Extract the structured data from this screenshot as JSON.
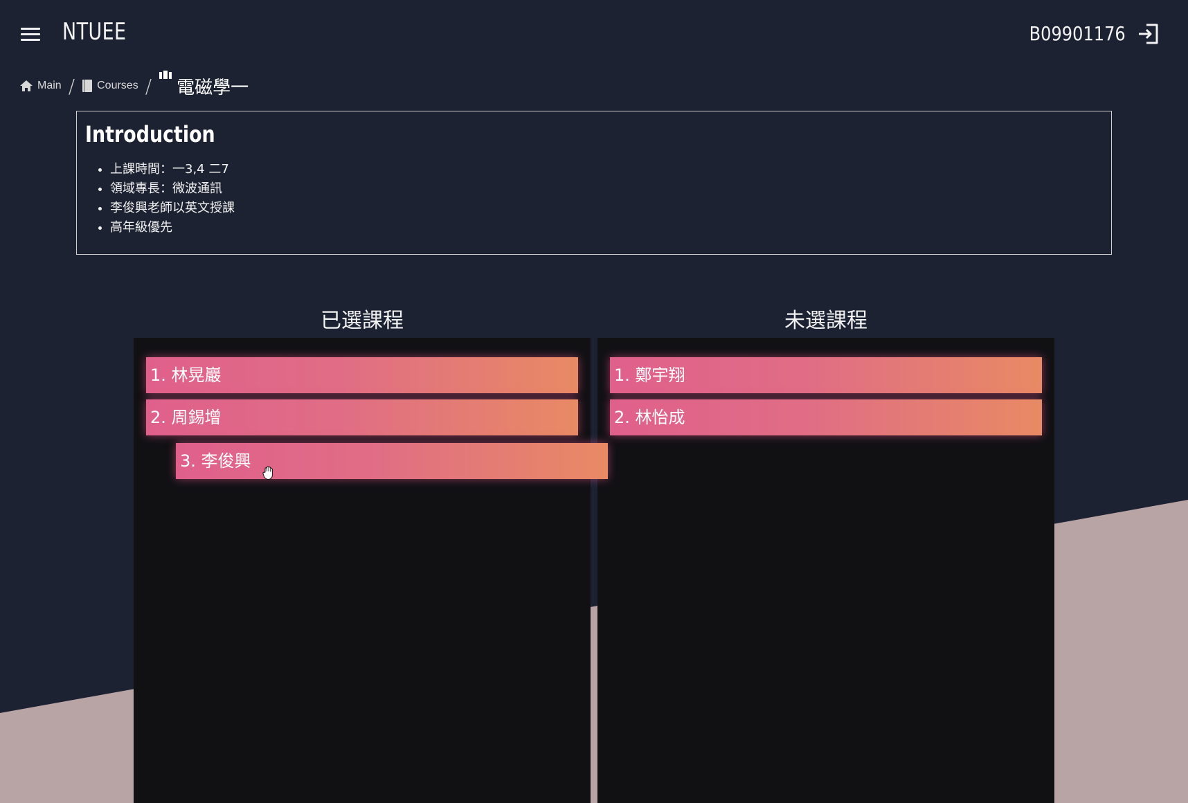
{
  "header": {
    "app_title": "NTUEE",
    "user_id": "B09901176"
  },
  "breadcrumb": {
    "main": "Main",
    "courses": "Courses",
    "current": "電磁學一"
  },
  "intro": {
    "title": "Introduction",
    "items": [
      "上課時間：一3,4 二7",
      "領域專長：微波通訊",
      "李俊興老師以英文授課",
      "高年級優先"
    ]
  },
  "selected": {
    "title": "已選課程",
    "items": [
      "1. 林晃巖",
      "2. 周錫增",
      "3. 李俊興"
    ]
  },
  "unselected": {
    "title": "未選課程",
    "items": [
      "1. 鄭宇翔",
      "2. 林怡成"
    ]
  },
  "colors": {
    "background": "#1c2232",
    "band": "#b8a3a5",
    "panel": "#111114",
    "card_start": "#e0608c",
    "card_end": "#e88a64"
  },
  "icons": [
    "menu-icon",
    "logout-icon",
    "home-icon",
    "book-icon",
    "course-icon",
    "hand-cursor-icon"
  ]
}
